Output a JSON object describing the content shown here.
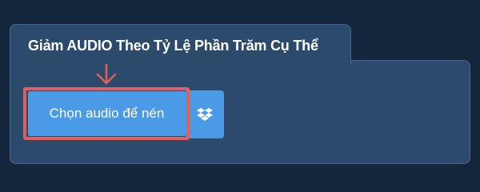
{
  "tab": {
    "title": "Giảm AUDIO Theo Tỷ Lệ Phần Trăm Cụ Thể"
  },
  "upload": {
    "choose_label": "Chọn audio để nén"
  },
  "icons": {
    "arrow": "down-arrow-icon",
    "dropbox": "dropbox-icon"
  },
  "colors": {
    "background": "#14263c",
    "panel": "#2c4a6c",
    "button": "#4a9ae8",
    "highlight": "#e0605c"
  }
}
